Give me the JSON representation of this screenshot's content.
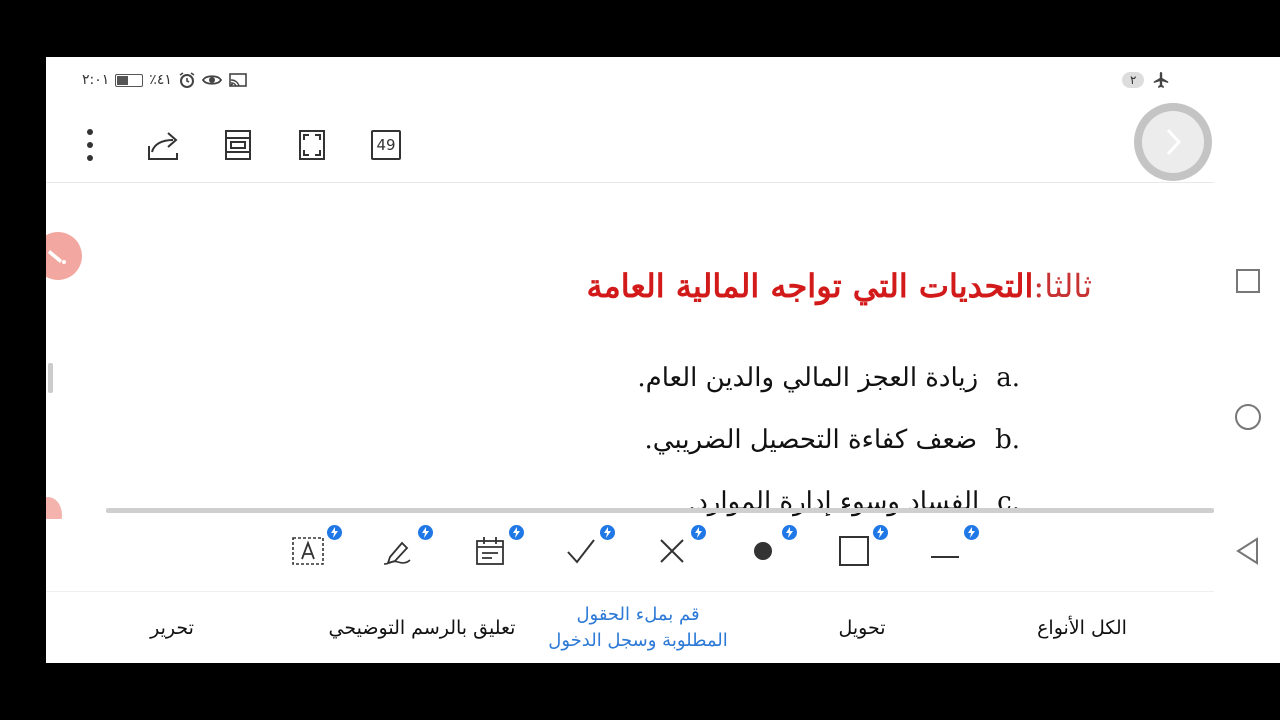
{
  "status_bar": {
    "time": "٢:٠١",
    "battery": "٪٤١",
    "battery_level": 0.41,
    "notifications": "٢"
  },
  "toolbar": {
    "page_count": "49"
  },
  "document": {
    "title_prefix": "ثالثا:",
    "title_main": "التحديات التي تواجه المالية العامة",
    "items": [
      {
        "letter": "a.",
        "text": "زيادة العجز المالي والدين العام."
      },
      {
        "letter": "b.",
        "text": "ضعف كفاءة التحصيل الضريبي."
      },
      {
        "letter": "c.",
        "text": "الفساد وسوء إدارة الموارد."
      }
    ]
  },
  "bottom_tabs": {
    "all_types": "الكل الأنواع",
    "convert": "تحويل",
    "fill_line1": "قم بملء الحقول",
    "fill_line2": "المطلوبة وسجل الدخول",
    "drawing_comment": "تعليق بالرسم التوضيحي",
    "edit": "تحرير"
  },
  "colors": {
    "title_red": "#d21a1a",
    "accent_blue": "#2c79d6",
    "badge_blue": "#1f78e6",
    "float_pink": "#f2a8a0"
  },
  "icons": {
    "more": "more-vertical-icon",
    "share": "share-icon",
    "reading_mode": "reading-mode-icon",
    "fullscreen": "fullscreen-icon",
    "next": "chevron-right-icon",
    "text_box": "text-box-icon",
    "signature": "signature-pen-icon",
    "date": "calendar-icon",
    "check": "check-mark-icon",
    "cross": "cross-mark-icon",
    "dot": "dot-icon",
    "square": "square-icon",
    "line": "line-icon"
  }
}
